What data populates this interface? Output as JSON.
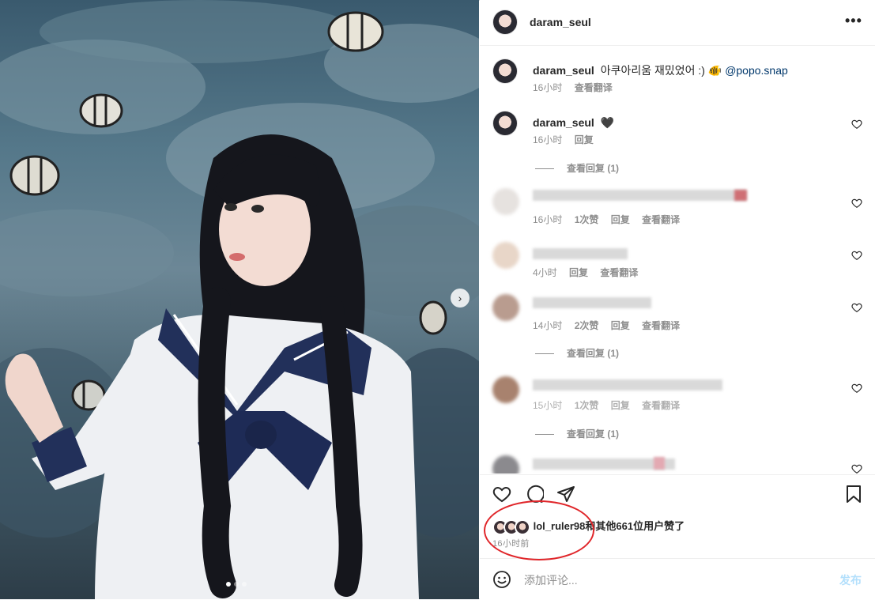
{
  "post": {
    "author": "daram_seul",
    "more_label": "•••"
  },
  "caption": {
    "user": "daram_seul",
    "text": "아쿠아리움 재밌었어 :) 🐠",
    "mention": "@popo.snap",
    "time": "16小时",
    "translate": "查看翻译"
  },
  "comments": [
    {
      "user": "daram_seul",
      "text": "🖤",
      "time": "16小时",
      "reply": "回复",
      "view_replies": "查看回复 (1)"
    },
    {
      "time": "16小时",
      "likes": "1次赞",
      "reply": "回复",
      "translate": "查看翻译"
    },
    {
      "time": "4小时",
      "reply": "回复",
      "translate": "查看翻译"
    },
    {
      "time": "14小时",
      "likes": "2次赞",
      "reply": "回复",
      "translate": "查看翻译",
      "view_replies": "查看回复 (1)"
    },
    {
      "time": "15小时",
      "likes": "1次赞",
      "reply": "回复",
      "translate": "查看翻译",
      "view_replies": "查看回复 (1)"
    }
  ],
  "likes": {
    "first_user": "lol_ruler98",
    "rest": "和其他661位用户赞了",
    "time_ago": "16小时前"
  },
  "compose": {
    "placeholder": "添加评论...",
    "post_label": "发布"
  },
  "carousel": {
    "next_label": "›",
    "slide_count": 3,
    "active_slide": 1
  },
  "colors": {
    "accent_link": "#00376b",
    "annotation_circle": "#e0262a",
    "post_disabled": "#b2dffc"
  }
}
